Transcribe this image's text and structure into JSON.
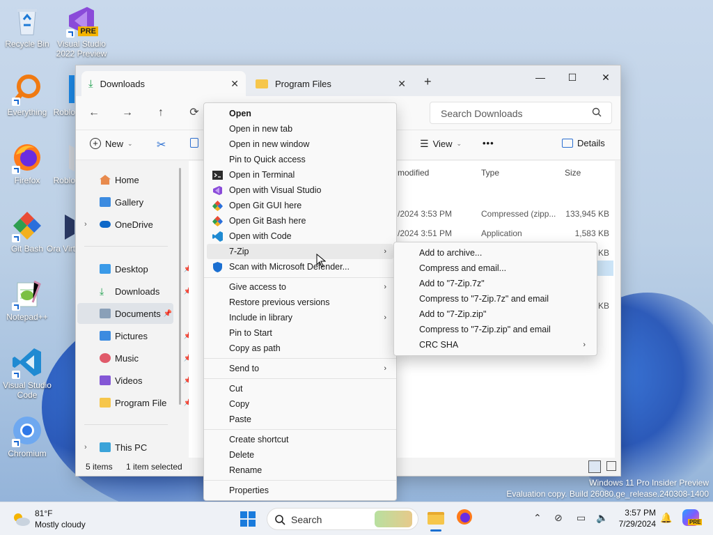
{
  "desktop": {
    "icons": [
      {
        "label": "Recycle Bin"
      },
      {
        "label": "Visual Studio 2022 Preview",
        "badge": "PRE"
      },
      {
        "label": "Everything"
      },
      {
        "label": "Roblo"
      },
      {
        "label": "Firefox"
      },
      {
        "label": "Roblo"
      },
      {
        "label": "Git Bash"
      },
      {
        "label": "Ora Virt"
      },
      {
        "label": "Notepad++"
      },
      {
        "label": "Visual Studio Code"
      },
      {
        "label": "Chromium"
      }
    ],
    "watermark_line1": "Windows 11 Pro Insider Preview",
    "watermark_line2": "Evaluation copy. Build 26080.ge_release.240308-1400"
  },
  "explorer": {
    "tabs": [
      {
        "label": "Downloads",
        "icon": "download-icon"
      },
      {
        "label": "Program Files",
        "icon": "folder-icon"
      }
    ],
    "new_tab": "+",
    "search_placeholder": "Search Downloads",
    "commands": {
      "new": "New",
      "view": "View",
      "more": "•••",
      "details": "Details"
    },
    "sidebar": {
      "home": "Home",
      "gallery": "Gallery",
      "onedrive": "OneDrive",
      "desktop": "Desktop",
      "downloads": "Downloads",
      "documents": "Documents",
      "pictures": "Pictures",
      "music": "Music",
      "videos": "Videos",
      "program_files": "Program File",
      "this_pc": "This PC"
    },
    "columns": {
      "modified": "modified",
      "type": "Type",
      "size": "Size"
    },
    "rows": [
      {
        "date": "/2024 3:53 PM",
        "type": "Compressed (zipp...",
        "size": "133,945 KB"
      },
      {
        "date": "/2024 3:51 PM",
        "type": "Application",
        "size": "1,583 KB"
      },
      {
        "size": "KB"
      },
      {
        "size": "KB"
      }
    ],
    "status": {
      "items": "5 items",
      "selected": "1 item selected"
    }
  },
  "context_menu": {
    "open": "Open",
    "open_new_tab": "Open in new tab",
    "open_new_window": "Open in new window",
    "pin_quick": "Pin to Quick access",
    "open_terminal": "Open in Terminal",
    "open_vs": "Open with Visual Studio",
    "git_gui": "Open Git GUI here",
    "git_bash": "Open Git Bash here",
    "open_code": "Open with Code",
    "seven_zip": "7-Zip",
    "defender": "Scan with Microsoft Defender...",
    "give_access": "Give access to",
    "restore": "Restore previous versions",
    "include_library": "Include in library",
    "pin_start": "Pin to Start",
    "copy_path": "Copy as path",
    "send_to": "Send to",
    "cut": "Cut",
    "copy": "Copy",
    "paste": "Paste",
    "create_shortcut": "Create shortcut",
    "delete": "Delete",
    "rename": "Rename",
    "properties": "Properties"
  },
  "submenu_7zip": {
    "add_archive": "Add to archive...",
    "compress_email": "Compress and email...",
    "add_7z": "Add to \"7-Zip.7z\"",
    "compress_7z_email": "Compress to \"7-Zip.7z\" and email",
    "add_zip": "Add to \"7-Zip.zip\"",
    "compress_zip_email": "Compress to \"7-Zip.zip\" and email",
    "crc_sha": "CRC SHA"
  },
  "taskbar": {
    "weather_temp": "81°F",
    "weather_desc": "Mostly cloudy",
    "search_label": "Search",
    "time": "3:57 PM",
    "date": "7/29/2024",
    "copilot_badge": "PRE"
  }
}
